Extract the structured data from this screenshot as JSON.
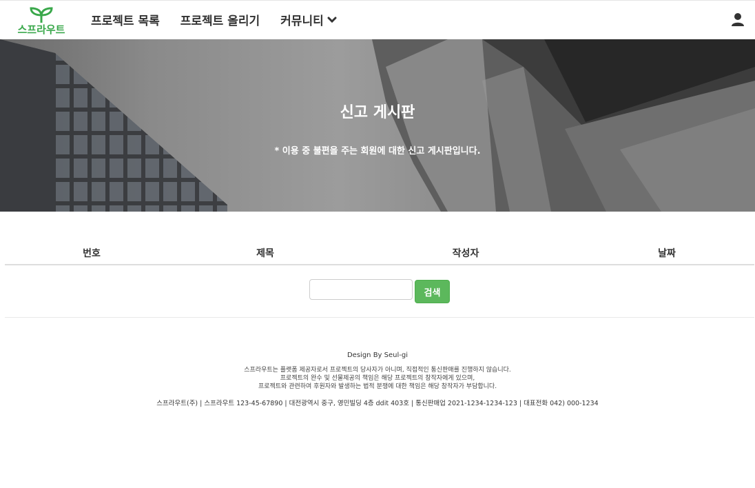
{
  "brand": {
    "logo_text": "스프라우트",
    "color": "#3aa84b"
  },
  "nav": {
    "items": [
      {
        "label": "프로젝트 목록"
      },
      {
        "label": "프로젝트 올리기"
      },
      {
        "label": "커뮤니티"
      }
    ],
    "dropdown_icon": "chevron-down-icon",
    "user_icon": "user-icon"
  },
  "hero": {
    "title": "신고 게시판",
    "subtitle": "* 이용 중 불편을 주는 회원에 대한 신고 게시판입니다."
  },
  "table": {
    "headers": [
      "번호",
      "제목",
      "작성자",
      "날짜"
    ],
    "rows": []
  },
  "search": {
    "value": "",
    "placeholder": "",
    "button_label": "검색",
    "button_color": "#5cb85c"
  },
  "footer": {
    "design_by": "Design By Seul-gi",
    "notice_lines": [
      "스프라우트는 플랫폼 제공자로서 프로젝트의 당사자가 아니며, 직접적인 통신판매를 진행하지 않습니다.",
      "프로젝트의 완수 및 선물제공의 책임은 해당 프로젝트의 창작자에게 있으며,",
      "프로젝트와 관련하여 후원자와 발생하는 법적 분쟁에 대한 책임은 해당 창작자가 부담합니다."
    ],
    "company_info": "스프라우트(주) | 스프라우트 123-45-67890 | 대전광역시 중구, 영민빌딩 4층 ddit 403호 | 통신판매업 2021-1234-1234-123 | 대표전화 042) 000-1234"
  }
}
